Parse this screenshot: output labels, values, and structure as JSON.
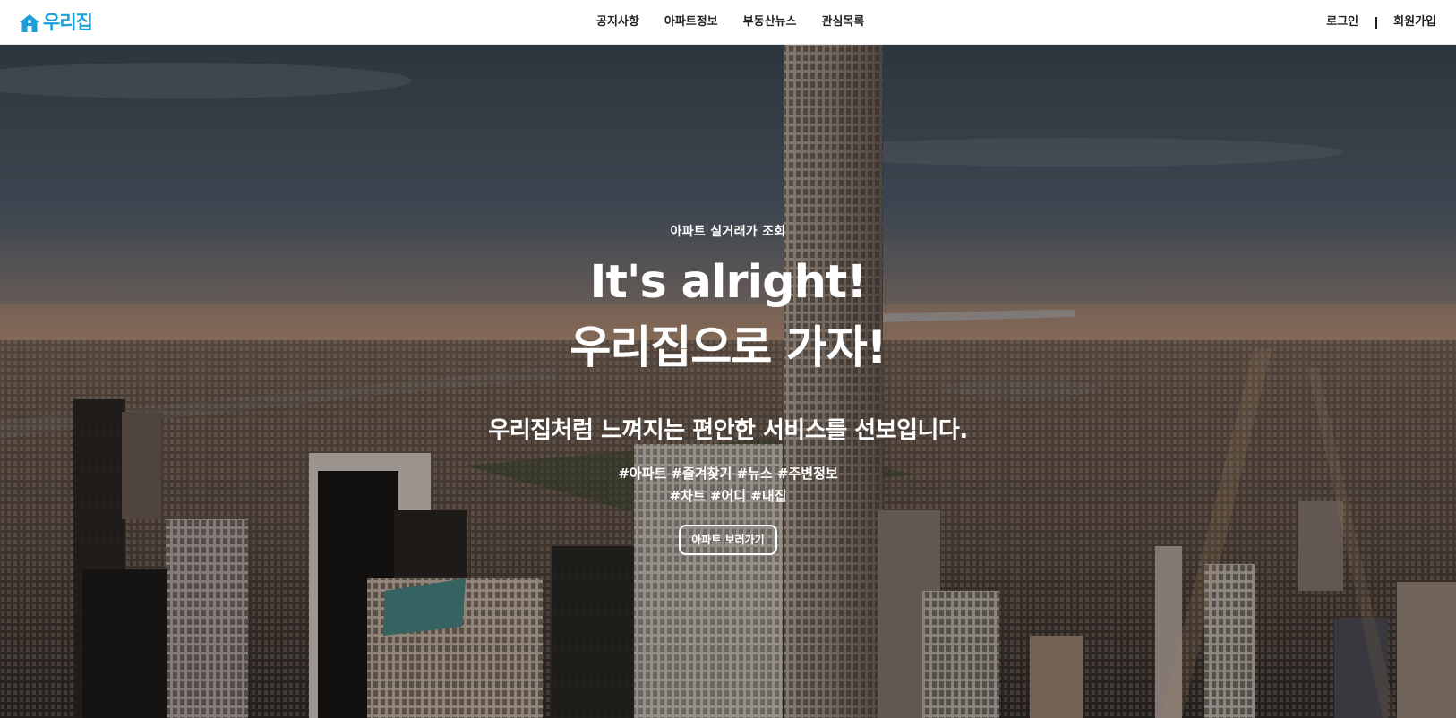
{
  "brand": {
    "name": "우리집",
    "icon": "house-icon",
    "color": "#1a9fd8"
  },
  "nav": {
    "items": [
      {
        "label": "공지사항"
      },
      {
        "label": "아파트정보"
      },
      {
        "label": "부동산뉴스"
      },
      {
        "label": "관심목록"
      }
    ],
    "login_label": "로그인",
    "signup_label": "회원가입"
  },
  "hero": {
    "eyebrow": "아파트 실거래가 조회",
    "title_line1": "It's alright!",
    "title_line2": "우리집으로 가자!",
    "subtitle": "우리집처럼 느껴지는 편안한 서비스를 선보입니다.",
    "tags_line1": "#아파트 #즐겨찾기 #뉴스 #주변정보",
    "tags_line2": "#차트 #어디 #내집",
    "cta_label": "아파트 보러가기",
    "background": "city-skyline-photo"
  }
}
